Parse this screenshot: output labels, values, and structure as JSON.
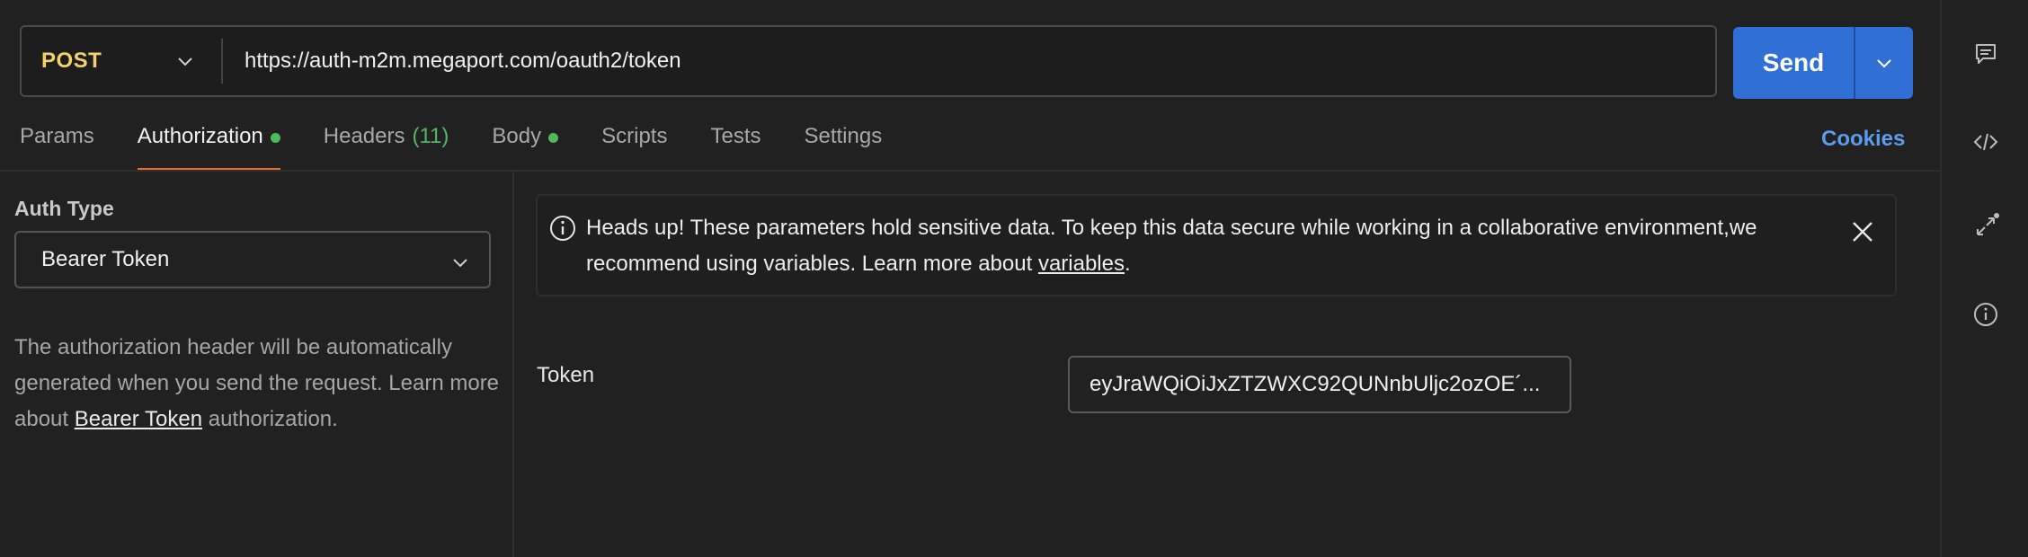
{
  "request": {
    "method": "POST",
    "url": "https://auth-m2m.megaport.com/oauth2/token",
    "send_label": "Send"
  },
  "tabs": [
    {
      "label": "Params"
    },
    {
      "label": "Authorization",
      "dot": true
    },
    {
      "label": "Headers",
      "count": "(11)"
    },
    {
      "label": "Body",
      "dot": true
    },
    {
      "label": "Scripts"
    },
    {
      "label": "Tests"
    },
    {
      "label": "Settings"
    }
  ],
  "cookies_label": "Cookies",
  "auth": {
    "type_label": "Auth Type",
    "type_value": "Bearer Token",
    "desc_before": "The authorization header will be automatically generated when you send the request. Learn more about ",
    "desc_link": "Bearer Token",
    "desc_after": " authorization."
  },
  "banner": {
    "text_before": "Heads up! These parameters hold sensitive data. To keep this data secure while working in a collaborative environment,we recommend using variables. Learn more about ",
    "link": "variables",
    "text_after": "."
  },
  "token": {
    "label": "Token",
    "value": "eyJraWQiOiJxZTZWXC92QUNnbUljc2ozOE´..."
  },
  "icons": {
    "right_rail": [
      "comment-icon",
      "code-icon",
      "expand-icon",
      "info-icon"
    ]
  },
  "colors": {
    "method": "#f3d16f",
    "send": "#2f6fd6",
    "active_tab_underline": "#f06a2e",
    "status_dot": "#4cbb5a",
    "cookies": "#5c9bf0"
  }
}
